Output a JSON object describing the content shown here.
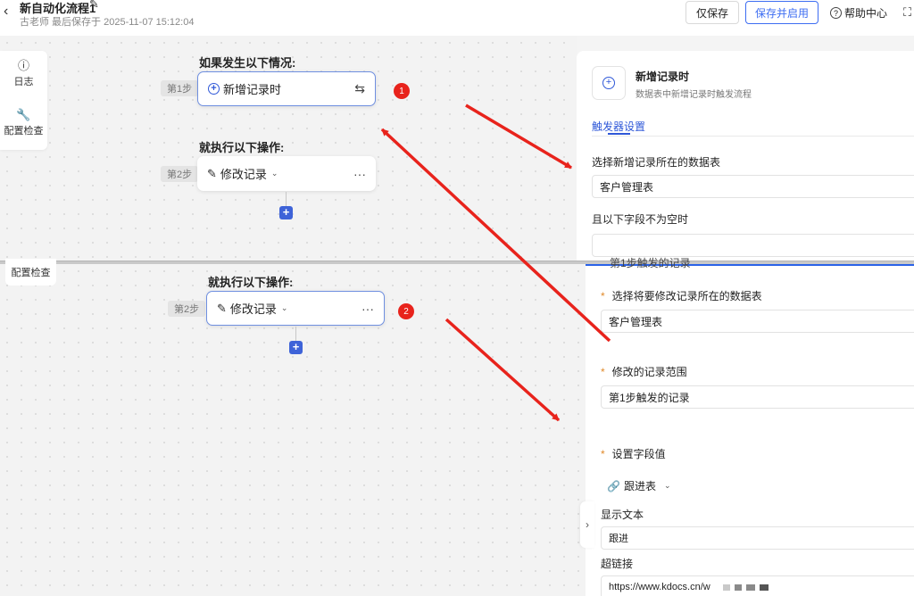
{
  "header": {
    "title": "新自动化流程1",
    "saved_info": "古老师 最后保存于 2025-11-07 15:12:04",
    "save_label": "仅保存",
    "save_enable_label": "保存并启用",
    "help_label": "帮助中心"
  },
  "toolpanel": {
    "log_label": "日志",
    "check_label": "配置检查"
  },
  "flow": {
    "condition_title": "如果发生以下情况:",
    "step1_label": "第1步",
    "trigger_label": "新增记录时",
    "action_title": "就执行以下操作:",
    "step2_label": "第2步",
    "action_label": "修改记录",
    "more_label": "···"
  },
  "annotations": {
    "num1": "1",
    "num2": "2"
  },
  "trigger_panel": {
    "title": "新增记录时",
    "subtitle": "数据表中新增记录时触发流程",
    "tab": "触发器设置",
    "table_label": "选择新增记录所在的数据表",
    "table_value": "客户管理表",
    "nonempty_label": "且以下字段不为空时",
    "nonempty_value": ""
  },
  "action_panel": {
    "partial_text": "第1步触发的记录",
    "table_label": "选择将要修改记录所在的数据表",
    "table_value": "客户管理表",
    "range_label": "修改的记录范围",
    "range_value": "第1步触发的记录",
    "set_fields_label": "设置字段值",
    "field_type": "跟进表",
    "display_text_label": "显示文本",
    "display_text_value": "跟进",
    "hyperlink_label": "超链接",
    "hyperlink_value": "https://www.kdocs.cn/w"
  },
  "colors": {
    "accent": "#2f58d8",
    "annotation_red": "#e8231c",
    "required": "#e0892a"
  }
}
